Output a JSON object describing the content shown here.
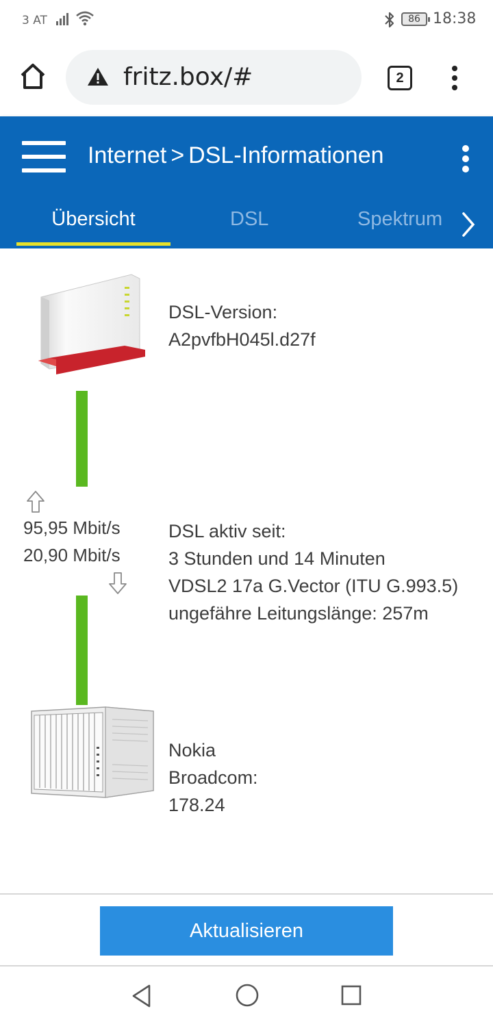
{
  "status_bar": {
    "carrier": "3 AT",
    "battery": "86",
    "time": "18:38",
    "icons": [
      "signal-icon",
      "wifi-icon",
      "bluetooth-icon",
      "battery-icon"
    ]
  },
  "browser": {
    "url": "fritz.box/#",
    "tab_count": "2",
    "icons": [
      "home-icon",
      "warning-icon",
      "tabs-icon",
      "more-vert-icon"
    ]
  },
  "header": {
    "breadcrumb_parent": "Internet",
    "breadcrumb_separator": ">",
    "breadcrumb_current": "DSL-Informationen",
    "tabs": [
      {
        "label": "Übersicht",
        "active": true
      },
      {
        "label": "DSL",
        "active": false
      },
      {
        "label": "Spektrum",
        "active": false
      }
    ],
    "colors": {
      "background": "#0b67b9",
      "indicator": "#e8e22a",
      "inactive_tab": "#8fb9e3"
    }
  },
  "overview": {
    "router": {
      "lines": [
        "DSL-Version:",
        "A2pvfbH045l.d27f"
      ]
    },
    "line": {
      "downstream": "95,95 Mbit/s",
      "upstream": "20,90 Mbit/s",
      "lines": [
        "DSL aktiv seit:",
        "3 Stunden und 14 Minuten",
        "VDSL2 17a G.Vector (ITU G.993.5)",
        "ungefähre Leitungslänge: 257m"
      ],
      "color": "#5ab820"
    },
    "dslam": {
      "lines": [
        "Nokia",
        "Broadcom:",
        "178.24"
      ]
    }
  },
  "footer": {
    "refresh_label": "Aktualisieren",
    "button_color": "#2a8ee0"
  },
  "navbar": {
    "icons": [
      "back-icon",
      "home-circle-icon",
      "recents-icon"
    ]
  }
}
